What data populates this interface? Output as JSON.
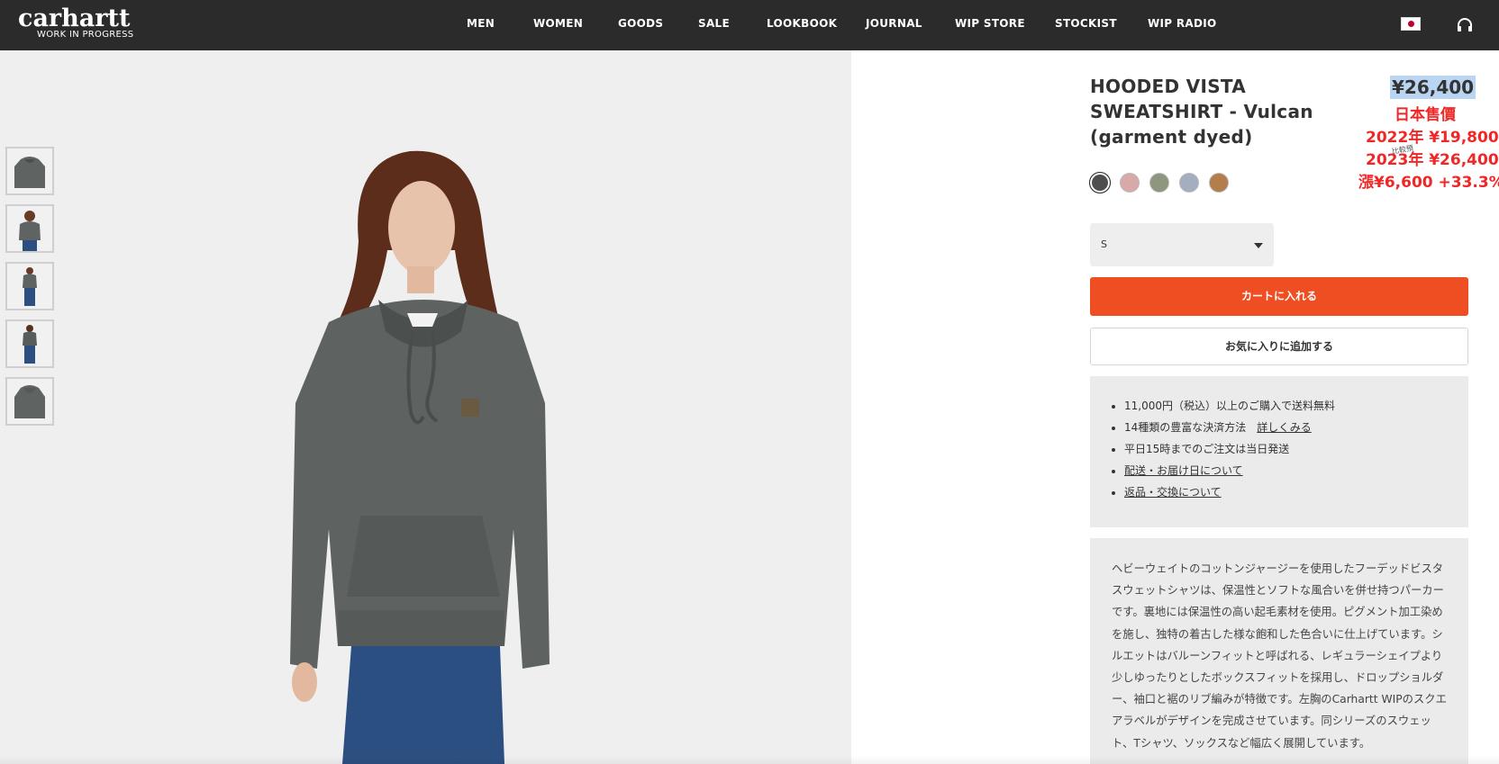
{
  "header": {
    "logo_main": "carhartt",
    "logo_sub": "WORK IN PROGRESS",
    "nav": [
      "MEN",
      "WOMEN",
      "GOODS",
      "SALE",
      "LOOKBOOK",
      "JOURNAL",
      "WIP STORE",
      "STOCKIST",
      "WIP RADIO"
    ],
    "region_icon": "japan-flag-icon",
    "audio_icon": "headphones-icon"
  },
  "gallery": {
    "thumbnails": [
      "front-hoodie",
      "model-front",
      "model-full",
      "model-back",
      "back-hoodie"
    ],
    "main_image": "model-wearing-hoodie"
  },
  "product": {
    "title": "HOODED VISTA SWEATSHIRT - Vulcan (garment dyed)",
    "price": "¥26,400",
    "swatches": [
      {
        "name": "Vulcan",
        "color": "#4e4e4e"
      },
      {
        "name": "Pink",
        "color": "#d8a9a9"
      },
      {
        "name": "Green",
        "color": "#8f9680"
      },
      {
        "name": "Blue",
        "color": "#a5aebf"
      },
      {
        "name": "Brown",
        "color": "#b37d4c"
      }
    ],
    "size_value": "S",
    "add_to_cart": "カートに入れる",
    "add_to_favorites": "お気に入りに追加する"
  },
  "annotation": {
    "line1": "日本售價",
    "line2": "2022年 ¥19,800",
    "line3": "2023年 ¥26,400",
    "line4": "漲¥6,600 +33.3%",
    "scribble": "比較預"
  },
  "info": {
    "item1": "11,000円（税込）以上のご購入で送料無料",
    "item2_text": "14種類の豊富な決済方法",
    "item2_link": "詳しくみる",
    "item3": "平日15時までのご注文は当日発送",
    "item4": "配送・お届け日について",
    "item5": "返品・交換について"
  },
  "description": "ヘビーウェイトのコットンジャージーを使用したフーデッドビスタスウェットシャツは、保温性とソフトな風合いを併せ持つパーカーです。裏地には保温性の高い起毛素材を使用。ピグメント加工染めを施し、独特の着古した様な飽和した色合いに仕上げています。シルエットはバルーンフィットと呼ばれる、レギュラーシェイプより少しゆったりとしたボックスフィットを採用し、ドロップショルダー、袖口と裾のリブ編みが特徴です。左胸のCarhartt WIPのスクエアラベルがデザインを完成させています。同シリーズのスウェット、Tシャツ、ソックスなど幅広く展開しています。",
  "colors": {
    "header_bg": "#2b2b2b",
    "accent": "#ef4e23",
    "annotation_red": "#ef2727",
    "panel_bg": "#ebebeb",
    "gallery_bg": "#efefef"
  }
}
